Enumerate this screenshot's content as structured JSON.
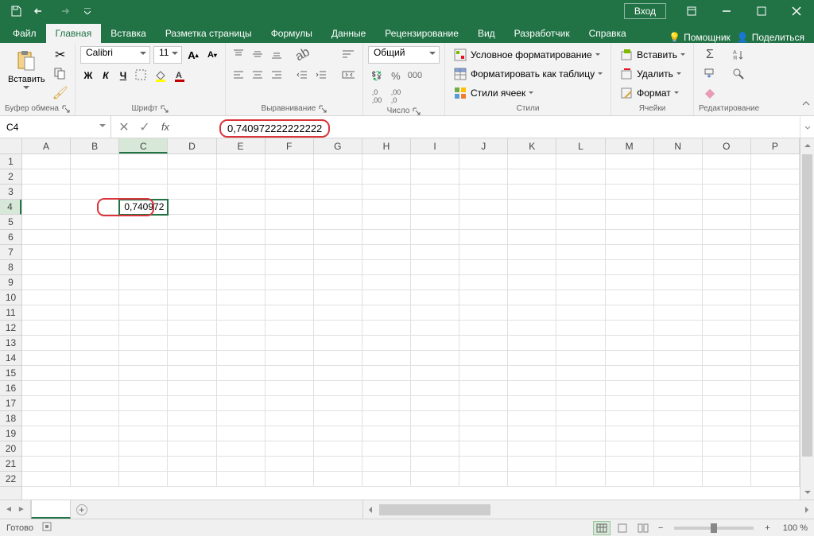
{
  "titlebar": {
    "signin": "Вход"
  },
  "tabs": {
    "file": "Файл",
    "home": "Главная",
    "insert": "Вставка",
    "layout": "Разметка страницы",
    "formulas": "Формулы",
    "data": "Данные",
    "review": "Рецензирование",
    "view": "Вид",
    "developer": "Разработчик",
    "help": "Справка",
    "tellme": "Помощник",
    "share": "Поделиться"
  },
  "ribbon": {
    "clipboard": {
      "paste": "Вставить",
      "label": "Буфер обмена"
    },
    "font": {
      "name": "Calibri",
      "size": "11",
      "label": "Шрифт",
      "bold": "Ж",
      "italic": "К",
      "underline": "Ч"
    },
    "alignment": {
      "label": "Выравнивание"
    },
    "number": {
      "format": "Общий",
      "label": "Число"
    },
    "styles": {
      "conditional": "Условное форматирование",
      "table": "Форматировать как таблицу",
      "cell": "Стили ячеек",
      "label": "Стили"
    },
    "cells": {
      "insert": "Вставить",
      "delete": "Удалить",
      "format": "Формат",
      "label": "Ячейки"
    },
    "editing": {
      "label": "Редактирование"
    }
  },
  "formula": {
    "namebox": "C4",
    "value": "0,740972222222222"
  },
  "grid": {
    "columns": [
      "A",
      "B",
      "C",
      "D",
      "E",
      "F",
      "G",
      "H",
      "I",
      "J",
      "K",
      "L",
      "M",
      "N",
      "O",
      "P"
    ],
    "rows": 22,
    "selected_cell": "C4",
    "selected_display": "0,740972",
    "selected_col_index": 2,
    "selected_row_index": 3
  },
  "sheets": {
    "active": " "
  },
  "status": {
    "ready": "Готово",
    "zoom": "100 %"
  }
}
